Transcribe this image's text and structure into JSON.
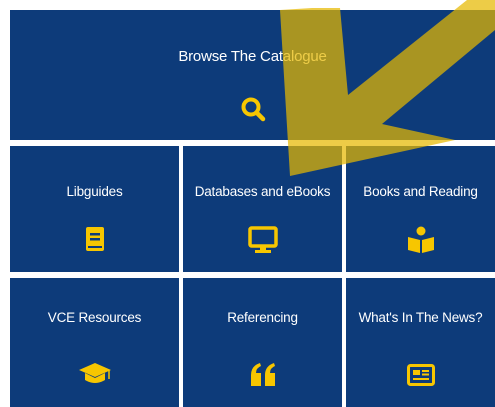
{
  "hero": {
    "label": "Browse The Catalogue",
    "icon": "search-icon"
  },
  "tiles": [
    {
      "label": "Libguides",
      "icon": "book-icon"
    },
    {
      "label": "Databases and eBooks",
      "icon": "monitor-icon"
    },
    {
      "label": "Books and Reading",
      "icon": "reader-icon"
    },
    {
      "label": "VCE Resources",
      "icon": "graduation-cap-icon"
    },
    {
      "label": "Referencing",
      "icon": "quote-icon"
    },
    {
      "label": "What's In The News?",
      "icon": "newspaper-icon"
    }
  ],
  "colors": {
    "tile_bg": "#0d3b7a",
    "icon": "#f7c600",
    "overlay_arrow": "#e6b800"
  }
}
